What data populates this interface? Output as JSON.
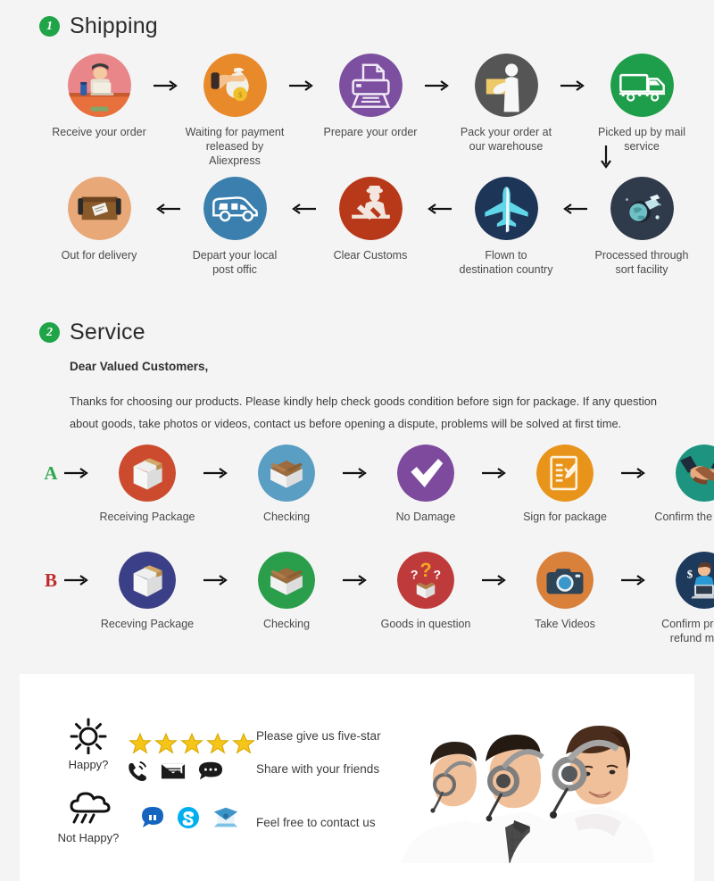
{
  "page": {
    "background": "#f4f4f4",
    "panel_background": "#ffffff",
    "accent_green": "#1fa548"
  },
  "shipping": {
    "number": "1",
    "title": "Shipping",
    "row1": [
      {
        "caption": "Receive your order",
        "icon": "person-at-laptop-icon",
        "color": "#e8868a"
      },
      {
        "caption": "Waiting for payment\nreleased by Aliexpress",
        "icon": "hand-money-bag-icon",
        "color": "#e8892a"
      },
      {
        "caption": "Prepare your order",
        "icon": "printer-icon",
        "color": "#7c4fa0"
      },
      {
        "caption": "Pack your order at\nour warehouse",
        "icon": "worker-packing-icon",
        "color": "#555555"
      },
      {
        "caption": "Picked up by mail service",
        "icon": "delivery-truck-icon",
        "color": "#1e9e4a"
      }
    ],
    "row2": [
      {
        "caption": "Out for delivery",
        "icon": "package-box-icon",
        "color": "#e8a878"
      },
      {
        "caption": "Depart your local\npost offic",
        "icon": "delivery-van-icon",
        "color": "#3a7fad"
      },
      {
        "caption": "Clear  Customs",
        "icon": "customs-officer-icon",
        "color": "#b8391a"
      },
      {
        "caption": "Flown to\ndestination country",
        "icon": "airplane-icon",
        "color": "#1d3557"
      },
      {
        "caption": "Processed through\nsort facility",
        "icon": "globe-sorting-icon",
        "color": "#2f3a4a"
      }
    ]
  },
  "service": {
    "number": "2",
    "title": "Service",
    "greeting": "Dear Valued Customers,",
    "paragraph": "Thanks for choosing  our products. Please kindly help check goods condition before sign for package. If any question about goods, take photos or videos, contact us before opening a dispute, problems will be solved at first time.",
    "row_a": {
      "letter": "A",
      "letter_color": "#2fa84f",
      "steps": [
        {
          "caption": "Receiving Package",
          "icon": "closed-box-icon",
          "color": "#cc4b2e"
        },
        {
          "caption": "Checking",
          "icon": "open-box-icon",
          "color": "#5b9ec4"
        },
        {
          "caption": "No Damage",
          "icon": "checkmark-icon",
          "color": "#7d4a9e"
        },
        {
          "caption": "Sign for package",
          "icon": "signed-document-icon",
          "color": "#e8941a"
        },
        {
          "caption": "Confirm the delivery",
          "icon": "handshake-icon",
          "color": "#1d9480"
        }
      ]
    },
    "row_b": {
      "letter": "B",
      "letter_color": "#c22b2b",
      "steps": [
        {
          "caption": "Receving Package",
          "icon": "closed-box-icon",
          "color": "#3b3f87"
        },
        {
          "caption": "Checking",
          "icon": "open-box-icon",
          "color": "#2a9e4a"
        },
        {
          "caption": "Goods in question",
          "icon": "question-box-icon",
          "color": "#bf3b3b"
        },
        {
          "caption": "Take Videos",
          "icon": "camera-icon",
          "color": "#d9803a"
        },
        {
          "caption": "Confirm problem,\nrefund money",
          "icon": "support-agent-money-icon",
          "color": "#1d3a5c"
        }
      ]
    }
  },
  "feedback": {
    "happy_label": "Happy?",
    "not_happy_label": "Not Happy?",
    "star_count": 5,
    "star_color": "#f5c518",
    "text_five_star": "Please give us five-star",
    "text_share": "Share with your friends",
    "text_contact": "Feel free to contact us",
    "happy_icons": [
      "phone-ringing-icon",
      "envelope-icon",
      "chat-bubble-icon"
    ],
    "not_happy_icons": [
      "message-bubble-icon",
      "skype-icon",
      "open-envelope-icon"
    ],
    "photo_alt": "customer-service-team-photo"
  }
}
